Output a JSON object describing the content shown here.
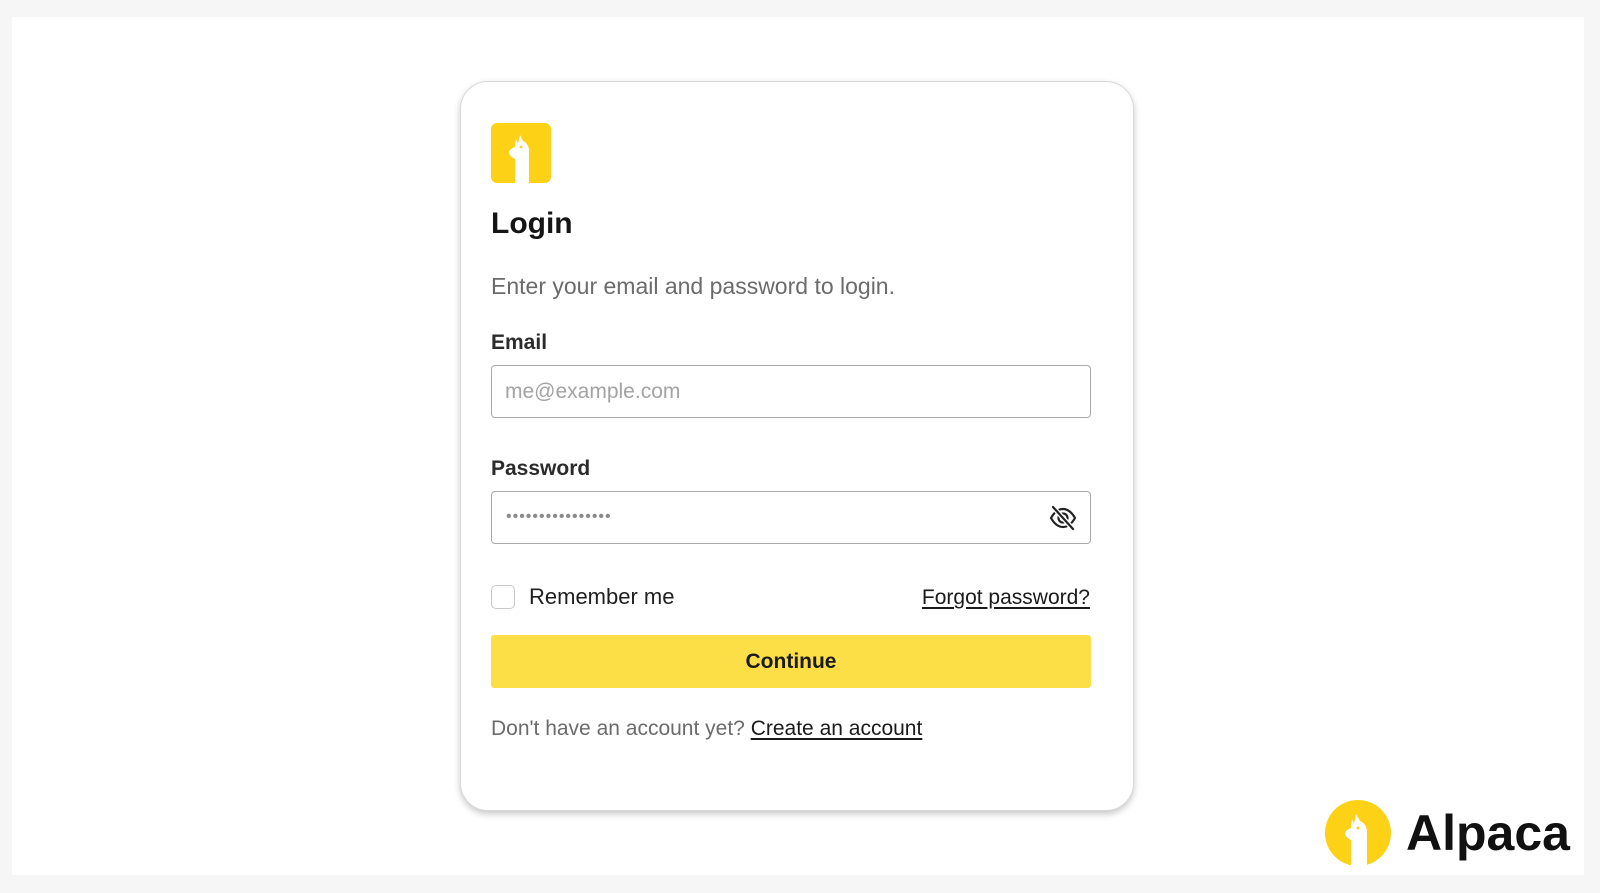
{
  "colors": {
    "brand_yellow": "#fcd116",
    "button_yellow": "#fcdf47",
    "muted_text": "#6b6b6b"
  },
  "card": {
    "logo_icon": "alpaca-icon",
    "title": "Login",
    "subtitle": "Enter your email and password to login."
  },
  "email": {
    "label": "Email",
    "placeholder": "me@example.com",
    "value": ""
  },
  "password": {
    "label": "Password",
    "masked_value": "••••••••••••••••",
    "toggle_icon": "eye-off-icon"
  },
  "remember": {
    "label": "Remember me",
    "checked": false
  },
  "forgot_label": "Forgot password?",
  "continue_label": "Continue",
  "signup": {
    "prompt": "Don't have an account yet?",
    "link": "Create an account"
  },
  "brand": {
    "logo_icon": "alpaca-icon",
    "name": "Alpaca"
  }
}
